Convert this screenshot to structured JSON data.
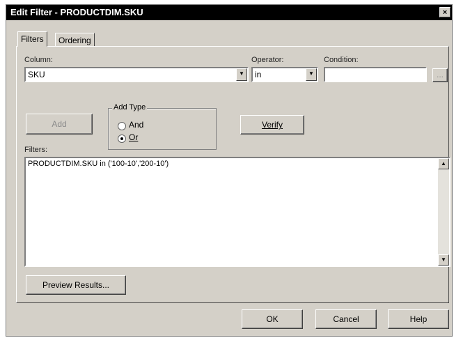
{
  "window": {
    "title": "Edit Filter - PRODUCTDIM.SKU",
    "close_glyph": "×"
  },
  "tabs": [
    {
      "label": "Filters"
    },
    {
      "label": "Ordering"
    }
  ],
  "column": {
    "label": "Column:",
    "value": "SKU"
  },
  "operator": {
    "label": "Operator:",
    "value": "in"
  },
  "condition": {
    "label": "Condition:",
    "value": "",
    "browse_label": "..."
  },
  "add_button": {
    "label": "Add"
  },
  "add_type": {
    "label": "Add Type",
    "options": [
      {
        "label": "And",
        "selected": false
      },
      {
        "label": "Or",
        "selected": true
      }
    ]
  },
  "verify_button": {
    "label": "Verify"
  },
  "filters": {
    "label": "Filters:",
    "text": "PRODUCTDIM.SKU in ('100-10','200-10')"
  },
  "preview_button": {
    "label": "Preview Results..."
  },
  "footer": {
    "ok_label": "OK",
    "cancel_label": "Cancel",
    "help_label": "Help"
  },
  "icons": {
    "dropdown": "▼",
    "scroll_up": "▲",
    "scroll_down": "▼"
  }
}
